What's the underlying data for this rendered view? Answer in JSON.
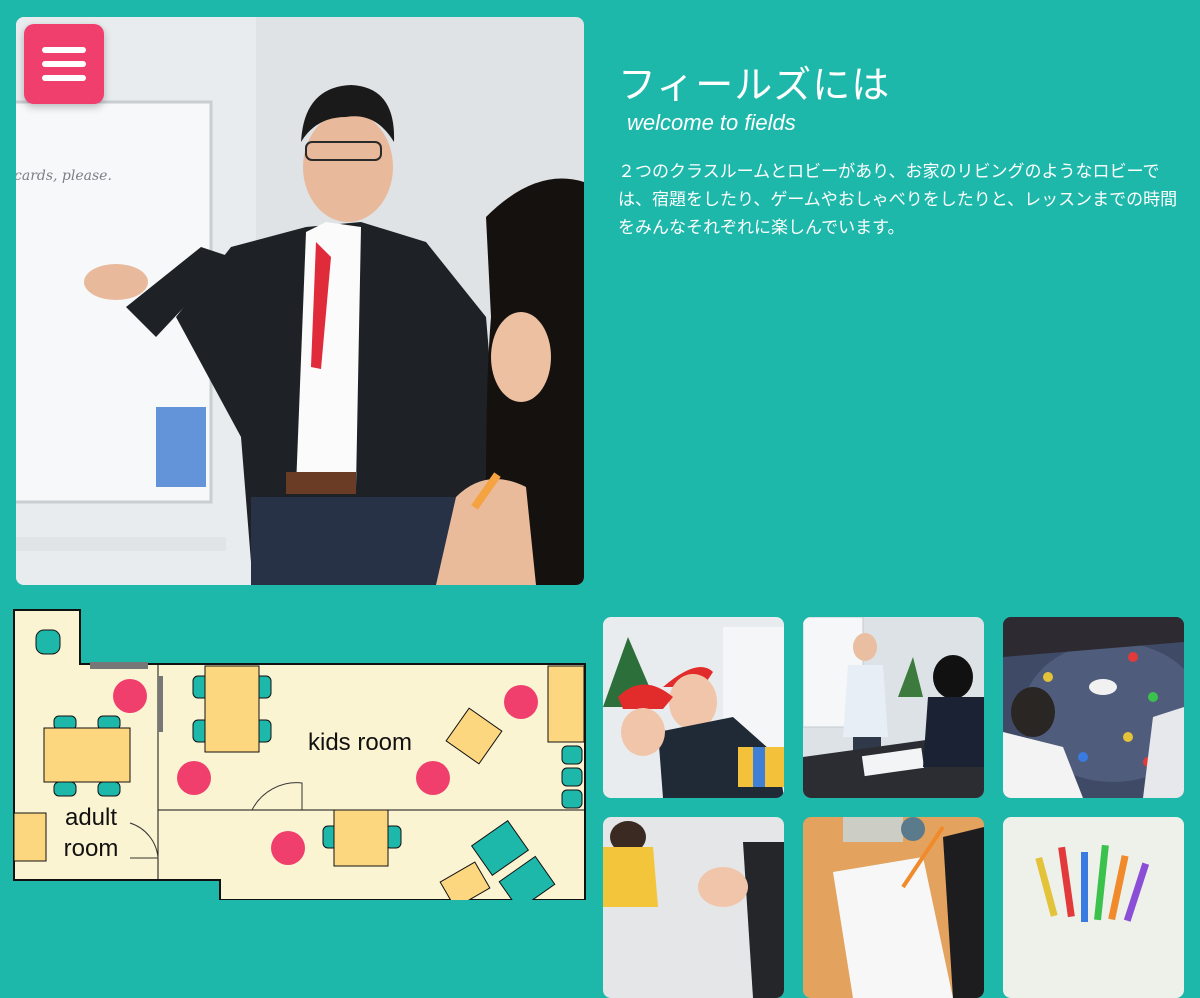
{
  "menu": {
    "icon": "hamburger-menu-icon"
  },
  "intro": {
    "title": "フィールズには",
    "subtitle": "welcome to fields",
    "description": "２つのクラスルームとロビーがあり、お家のリビングのようなロビーでは、宿題をしたり、ゲームやおしゃべりをしたりと、レッスンまでの時間をみんなそれぞれに楽しんでいます。"
  },
  "hero_photo": {
    "whiteboard_text": "cards, please."
  },
  "floor_plan": {
    "rooms": {
      "kids": "kids room",
      "adult_line1": "adult",
      "adult_line2": "room"
    }
  },
  "colors": {
    "background": "#1eb8ab",
    "menu_button": "#f03f6d",
    "floor_fill": "#fbf4d2",
    "table": "#fdd77f",
    "chair": "#1eb8ab",
    "stool": "#f03f6d"
  }
}
